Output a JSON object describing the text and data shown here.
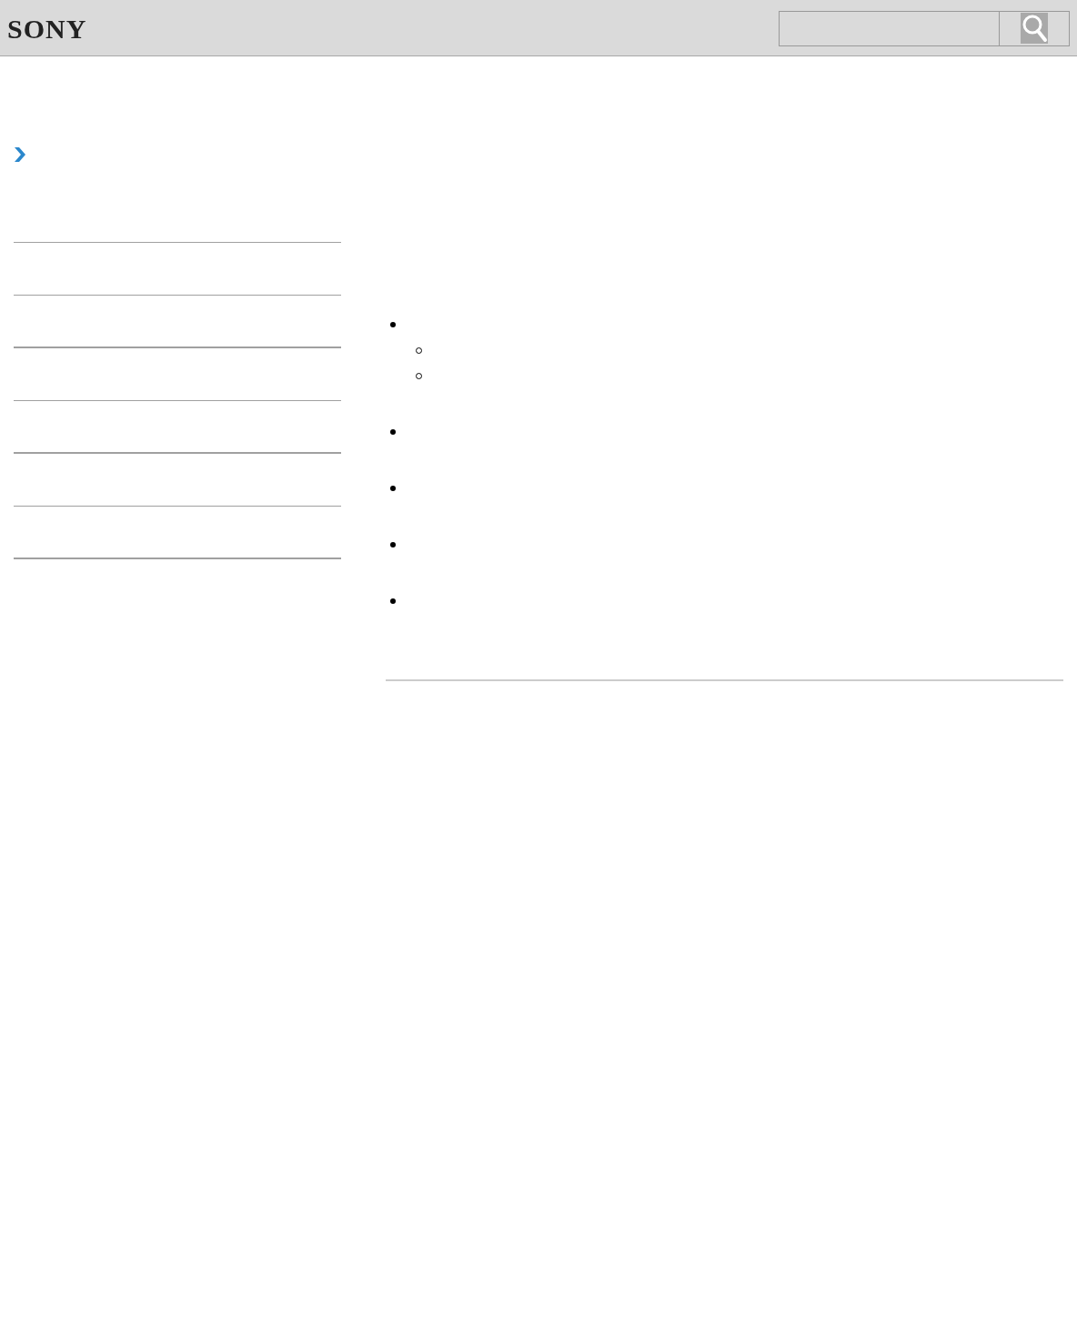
{
  "header": {
    "logo": "SONY"
  },
  "bullets": [
    {
      "kind": "disc",
      "children": [
        {
          "kind": "circle"
        },
        {
          "kind": "circle"
        }
      ]
    },
    {
      "kind": "disc"
    },
    {
      "kind": "disc"
    },
    {
      "kind": "disc"
    },
    {
      "kind": "disc"
    }
  ]
}
